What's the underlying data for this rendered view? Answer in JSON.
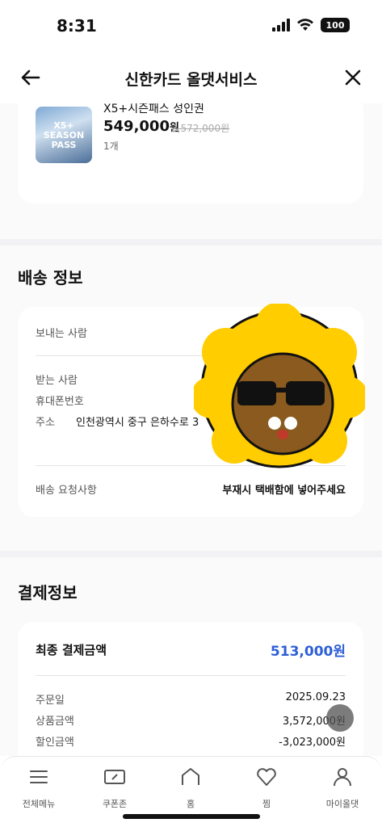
{
  "status": {
    "time": "8:31",
    "battery": "100"
  },
  "header": {
    "title": "신한카드 올댓서비스"
  },
  "product": {
    "thumb_text": "X5+ SEASON PASS",
    "name": "X5+시즌패스 성인권",
    "price": "549,000",
    "price_unit": "원",
    "original_price": "3,572,000원",
    "quantity": "1개"
  },
  "shipping": {
    "title": "배송 정보",
    "sender_label": "보내는 사람",
    "receiver_label": "받는 사람",
    "phone_label": "휴대폰번호",
    "address_label": "주소",
    "address_value": "인천광역시 중구 은하수로 3",
    "request_label": "배송 요청사항",
    "request_value": "부재시 택배함에 넣어주세요"
  },
  "payment": {
    "title": "결제정보",
    "total_label": "최종 결제금액",
    "total_value": "513,000원",
    "rows": [
      {
        "label": "주문일",
        "value": "2025.09.23"
      },
      {
        "label": "상품금액",
        "value": "3,572,000원"
      },
      {
        "label": "할인금액",
        "value": "-3,023,000원"
      }
    ]
  },
  "nav": [
    {
      "label": "전체메뉴",
      "icon": "menu-icon"
    },
    {
      "label": "쿠폰존",
      "icon": "coupon-icon"
    },
    {
      "label": "홈",
      "icon": "home-icon"
    },
    {
      "label": "찜",
      "icon": "heart-icon"
    },
    {
      "label": "마이올댓",
      "icon": "person-icon"
    }
  ],
  "colors": {
    "accent": "#2f5fd6",
    "background": "#f2f2f4"
  }
}
